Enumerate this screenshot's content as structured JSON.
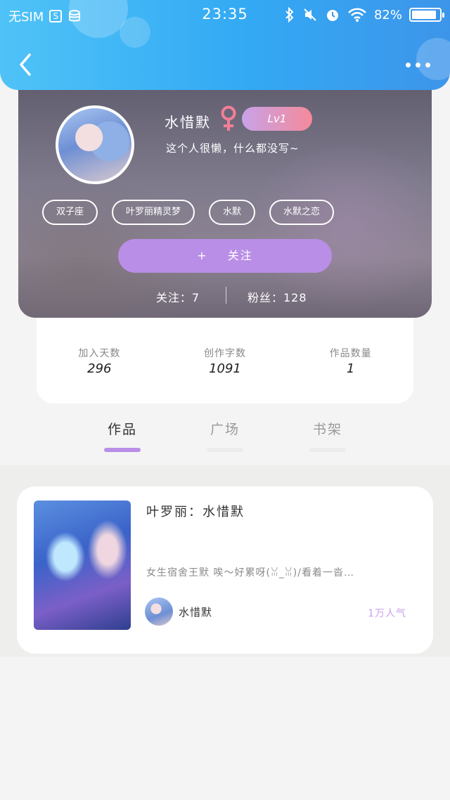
{
  "status_bar": {
    "carrier": "无SIM",
    "time": "23:35",
    "battery_percent": "82%",
    "battery_level": 0.82
  },
  "profile": {
    "username": "水惜默",
    "gender": "female",
    "level": "Lv1",
    "bio": "这个人很懒，什么都没写~",
    "tags": [
      "双子座",
      "叶罗丽精灵梦",
      "水默",
      "水默之恋"
    ],
    "follow_button": {
      "icon": "+",
      "label": "关注"
    },
    "following": "关注：7",
    "fans": "粉丝：128"
  },
  "stats": [
    {
      "label": "加入天数",
      "value": "296"
    },
    {
      "label": "创作字数",
      "value": "1091"
    },
    {
      "label": "作品数量",
      "value": "1"
    }
  ],
  "tabs": [
    {
      "label": "作品",
      "active": true
    },
    {
      "label": "广场",
      "active": false
    },
    {
      "label": "书架",
      "active": false
    }
  ],
  "works": [
    {
      "title": "叶罗丽：水惜默",
      "description": "女生宿舍王默 唉～好累呀(ꈍ_ꈍ)/看着一沓…",
      "author": "水惜默",
      "popularity": "1万人气"
    }
  ],
  "colors": {
    "header_gradient_start": "#4fc3f7",
    "header_gradient_end": "#3d95ea",
    "accent_purple": "#b98ee6",
    "gender_pink": "#f27f97",
    "level_gradient_start": "#c8a2e8",
    "level_gradient_end": "#f48a9a",
    "popularity_text": "#c9a0ee"
  }
}
